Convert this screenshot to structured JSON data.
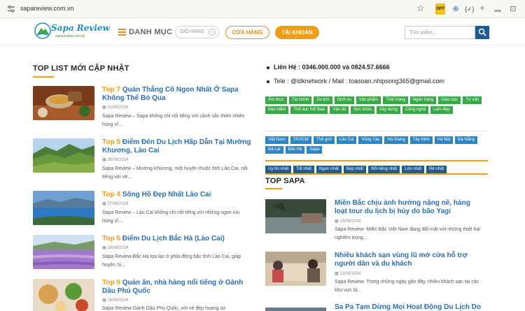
{
  "browser": {
    "url": "sapareview.com.vn",
    "ext_off_label": "OFF",
    "ext_new_label": "new"
  },
  "header": {
    "logo_text": "Sapa Review",
    "logo_sub": "sapareview.com.vn",
    "menu_label": "DANH MỤC",
    "cart_label": "GIỎ HÀNG",
    "store_label": "CỬA HÀNG",
    "account_label": "TÀI KHOẢN",
    "search_placeholder": "Tìm kiếm..."
  },
  "left": {
    "section_title": "TOP LIST MỚI CẬP NHẬT",
    "posts": [
      {
        "num": "Top 7",
        "title": " Quán Thắng Cố Ngon Nhất Ở Sapa Không Thể Bỏ Qua",
        "date": "02/09/2024",
        "excerpt": "Sapa Review – Sapa không chỉ nổi tiếng với cảnh sắc thiên nhiên hùng vĩ..."
      },
      {
        "num": "Top 5",
        "title": " Điểm Đến Du Lịch Hấp Dẫn Tại Mường Khương, Lào Cai",
        "date": "28/08/2024",
        "excerpt": "Sapa Review – Mường Khương, một huyện thuộc tỉnh Lào Cai, nổi tiếng với vẻ..."
      },
      {
        "num": "Top 4",
        "title": " Sông Hồ Đẹp Nhất Lào Cai",
        "date": "27/08/2024",
        "excerpt": "Sapa Review – Lào Cai không chỉ nổi tiếng với những ngọn núi hùng vĩ,..."
      },
      {
        "num": "Top 5",
        "title": " Điểm Du Lịch Bắc Hà (Lào Cai)",
        "date": "18/08/2024",
        "excerpt": "Sapa Review-Bắc Hà tọa lạc ở phía đông bắc tỉnh Lào Cai, giáp huyện Si..."
      },
      {
        "num": "Top 9",
        "title": " Quán ăn, nhà hàng nổi tiếng ở Gành Dầu Phú Quốc",
        "date": "18/08/2024",
        "excerpt": "Sapa Review-Gành Dầu Phú Quốc, với vẻ đẹp hoang sơ"
      }
    ]
  },
  "right": {
    "contact_phone_label": "Liên Hệ",
    "contact_phone": " : 0346.000.000 và 0824.57.6666",
    "contact_tele": "Tele : @ldknetwork / Mail : toasoan.nhipsong365@gmail.com",
    "tags_green": [
      "Ẩm thực",
      "Tài chính",
      "Du lịch",
      "Dịch vụ",
      "Sản phẩm",
      "Thời trang",
      "Ngân hàng",
      "Giáo dục",
      "Tư vấn",
      "Bảo hiểm",
      "Thể dục thể thao",
      "Vận tải",
      "Sức khỏe",
      "Xây dựng",
      "Công nghệ",
      "Làm đẹp"
    ],
    "tags_blue": [
      "Việt Nam",
      "TP.HCM",
      "Thế giới",
      "Lào Cai",
      "Vũng Tàu",
      "Hà Giang",
      "Tây Ninh",
      "Hà Nội",
      "Đà Nẵng",
      "Đà Lạt",
      "Bắc Hà",
      "Sapa"
    ],
    "tags_navy": [
      "Uy tín nhất",
      "Tốt nhất",
      "Ngon nhất",
      "Đẹp nhất",
      "Nổi tiếng nhất",
      "Lớn nhất",
      "Rẻ nhất"
    ],
    "section_title": "TOP SAPA",
    "posts": [
      {
        "title": "Miền Bắc chịu ảnh hưởng nặng nề, hàng loạt tour du lịch bị hủy do bão Yagi",
        "date": "13/09/2024",
        "excerpt": "Sapa Review- Miền Bắc Việt Nam đang đối mặt với những thiệt hại nghiêm trọng..."
      },
      {
        "title": "Nhiều khách sạn vùng lũ mở cửa hỗ trợ người dân và du khách",
        "date": "13/09/2024",
        "excerpt": "Sapa Review- Trong những ngày gần đây, nhiều khách sạn tại các khu vực bị..."
      },
      {
        "title": "Sa Pa Tạm Dừng Mọi Hoạt Động Du Lịch Do",
        "date": "",
        "excerpt": ""
      }
    ]
  }
}
